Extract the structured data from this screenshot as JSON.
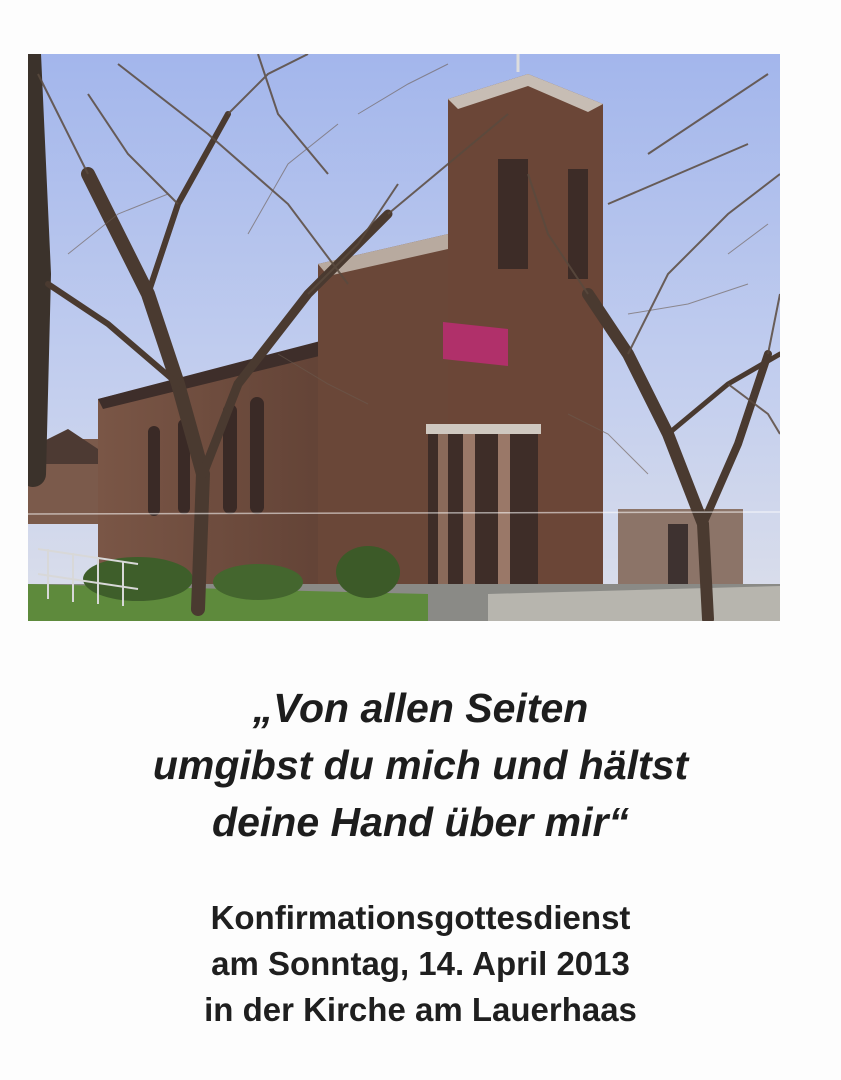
{
  "photo": {
    "subject": "church-with-bell-tower",
    "colors": {
      "sky": "#a8b9ea",
      "brick": "#6e4a3c",
      "grass": "#5e8a3c",
      "banner": "#b0306a"
    }
  },
  "quote": {
    "line1": "„Von allen Seiten",
    "line2": "umgibst du mich und hältst",
    "line3": "deine Hand über mir“"
  },
  "event": {
    "line1": "Konfirmationsgottesdienst",
    "line2": "am Sonntag, 14. April 2013",
    "line3": "in der Kirche am Lauerhaas"
  }
}
